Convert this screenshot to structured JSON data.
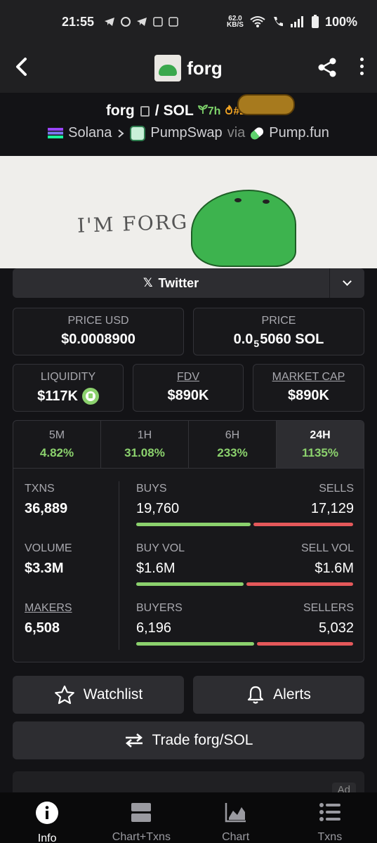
{
  "status": {
    "time": "21:55",
    "net_speed_top": "62.0",
    "net_speed_bottom": "KB/S",
    "battery": "100%"
  },
  "header": {
    "title": "forg"
  },
  "pair": {
    "base": "forg",
    "separator": "/",
    "quote": "SOL",
    "age": "7h",
    "rank": "#2",
    "boosts": "50",
    "chain": "Solana",
    "dex": "PumpSwap",
    "via": "via",
    "launchpad": "Pump.fun"
  },
  "banner": {
    "text": "I'M FORG"
  },
  "social": {
    "twitter_label": "Twitter"
  },
  "stats": {
    "price_usd_label": "PRICE USD",
    "price_usd": "$0.0008900",
    "price_label": "PRICE",
    "price_prefix": "0.0",
    "price_subscript": "5",
    "price_suffix": "5060 SOL",
    "liquidity_label": "LIQUIDITY",
    "liquidity": "$117K",
    "fdv_label": "FDV",
    "fdv": "$890K",
    "mcap_label": "MARKET CAP",
    "mcap": "$890K"
  },
  "timeframes": [
    {
      "label": "5M",
      "value": "4.82%"
    },
    {
      "label": "1H",
      "value": "31.08%"
    },
    {
      "label": "6H",
      "value": "233%"
    },
    {
      "label": "24H",
      "value": "1135%"
    }
  ],
  "activity": {
    "txns_label": "TXNS",
    "txns": "36,889",
    "buys_label": "BUYS",
    "buys": "19,760",
    "sells_label": "SELLS",
    "sells": "17,129",
    "buys_ratio": 0.536,
    "volume_label": "VOLUME",
    "volume": "$3.3M",
    "buy_vol_label": "BUY VOL",
    "buy_vol": "$1.6M",
    "sell_vol_label": "SELL VOL",
    "sell_vol": "$1.6M",
    "buy_vol_ratio": 0.5,
    "makers_label": "MAKERS",
    "makers": "6,508",
    "buyers_label": "BUYERS",
    "buyers": "6,196",
    "sellers_label": "SELLERS",
    "sellers": "5,032",
    "buyers_ratio": 0.552
  },
  "actions": {
    "watchlist": "Watchlist",
    "alerts": "Alerts",
    "trade": "Trade forg/SOL"
  },
  "ad": {
    "label": "Ad"
  },
  "nav": [
    {
      "label": "Info",
      "icon": "info-icon"
    },
    {
      "label": "Chart+Txns",
      "icon": "split-view-icon"
    },
    {
      "label": "Chart",
      "icon": "chart-icon"
    },
    {
      "label": "Txns",
      "icon": "list-icon"
    }
  ],
  "colors": {
    "positive": "#8bd16d",
    "negative": "#e4585a",
    "background": "#131316"
  }
}
